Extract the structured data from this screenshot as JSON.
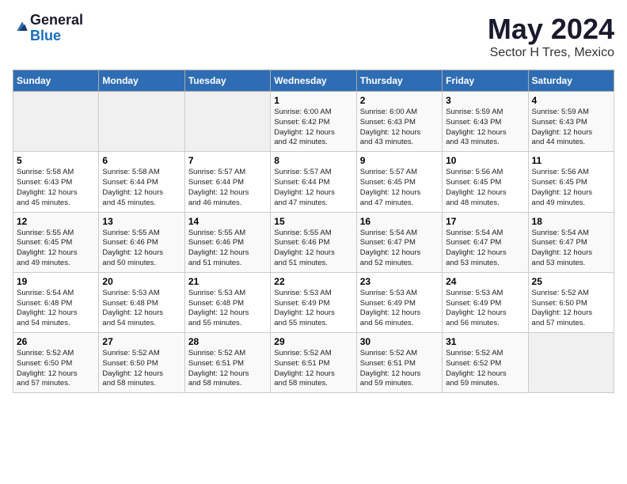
{
  "logo": {
    "general": "General",
    "blue": "Blue"
  },
  "title": "May 2024",
  "subtitle": "Sector H Tres, Mexico",
  "days_of_week": [
    "Sunday",
    "Monday",
    "Tuesday",
    "Wednesday",
    "Thursday",
    "Friday",
    "Saturday"
  ],
  "weeks": [
    [
      {
        "day": "",
        "info": ""
      },
      {
        "day": "",
        "info": ""
      },
      {
        "day": "",
        "info": ""
      },
      {
        "day": "1",
        "info": "Sunrise: 6:00 AM\nSunset: 6:42 PM\nDaylight: 12 hours\nand 42 minutes."
      },
      {
        "day": "2",
        "info": "Sunrise: 6:00 AM\nSunset: 6:43 PM\nDaylight: 12 hours\nand 43 minutes."
      },
      {
        "day": "3",
        "info": "Sunrise: 5:59 AM\nSunset: 6:43 PM\nDaylight: 12 hours\nand 43 minutes."
      },
      {
        "day": "4",
        "info": "Sunrise: 5:59 AM\nSunset: 6:43 PM\nDaylight: 12 hours\nand 44 minutes."
      }
    ],
    [
      {
        "day": "5",
        "info": "Sunrise: 5:58 AM\nSunset: 6:43 PM\nDaylight: 12 hours\nand 45 minutes."
      },
      {
        "day": "6",
        "info": "Sunrise: 5:58 AM\nSunset: 6:44 PM\nDaylight: 12 hours\nand 45 minutes."
      },
      {
        "day": "7",
        "info": "Sunrise: 5:57 AM\nSunset: 6:44 PM\nDaylight: 12 hours\nand 46 minutes."
      },
      {
        "day": "8",
        "info": "Sunrise: 5:57 AM\nSunset: 6:44 PM\nDaylight: 12 hours\nand 47 minutes."
      },
      {
        "day": "9",
        "info": "Sunrise: 5:57 AM\nSunset: 6:45 PM\nDaylight: 12 hours\nand 47 minutes."
      },
      {
        "day": "10",
        "info": "Sunrise: 5:56 AM\nSunset: 6:45 PM\nDaylight: 12 hours\nand 48 minutes."
      },
      {
        "day": "11",
        "info": "Sunrise: 5:56 AM\nSunset: 6:45 PM\nDaylight: 12 hours\nand 49 minutes."
      }
    ],
    [
      {
        "day": "12",
        "info": "Sunrise: 5:55 AM\nSunset: 6:45 PM\nDaylight: 12 hours\nand 49 minutes."
      },
      {
        "day": "13",
        "info": "Sunrise: 5:55 AM\nSunset: 6:46 PM\nDaylight: 12 hours\nand 50 minutes."
      },
      {
        "day": "14",
        "info": "Sunrise: 5:55 AM\nSunset: 6:46 PM\nDaylight: 12 hours\nand 51 minutes."
      },
      {
        "day": "15",
        "info": "Sunrise: 5:55 AM\nSunset: 6:46 PM\nDaylight: 12 hours\nand 51 minutes."
      },
      {
        "day": "16",
        "info": "Sunrise: 5:54 AM\nSunset: 6:47 PM\nDaylight: 12 hours\nand 52 minutes."
      },
      {
        "day": "17",
        "info": "Sunrise: 5:54 AM\nSunset: 6:47 PM\nDaylight: 12 hours\nand 53 minutes."
      },
      {
        "day": "18",
        "info": "Sunrise: 5:54 AM\nSunset: 6:47 PM\nDaylight: 12 hours\nand 53 minutes."
      }
    ],
    [
      {
        "day": "19",
        "info": "Sunrise: 5:54 AM\nSunset: 6:48 PM\nDaylight: 12 hours\nand 54 minutes."
      },
      {
        "day": "20",
        "info": "Sunrise: 5:53 AM\nSunset: 6:48 PM\nDaylight: 12 hours\nand 54 minutes."
      },
      {
        "day": "21",
        "info": "Sunrise: 5:53 AM\nSunset: 6:48 PM\nDaylight: 12 hours\nand 55 minutes."
      },
      {
        "day": "22",
        "info": "Sunrise: 5:53 AM\nSunset: 6:49 PM\nDaylight: 12 hours\nand 55 minutes."
      },
      {
        "day": "23",
        "info": "Sunrise: 5:53 AM\nSunset: 6:49 PM\nDaylight: 12 hours\nand 56 minutes."
      },
      {
        "day": "24",
        "info": "Sunrise: 5:53 AM\nSunset: 6:49 PM\nDaylight: 12 hours\nand 56 minutes."
      },
      {
        "day": "25",
        "info": "Sunrise: 5:52 AM\nSunset: 6:50 PM\nDaylight: 12 hours\nand 57 minutes."
      }
    ],
    [
      {
        "day": "26",
        "info": "Sunrise: 5:52 AM\nSunset: 6:50 PM\nDaylight: 12 hours\nand 57 minutes."
      },
      {
        "day": "27",
        "info": "Sunrise: 5:52 AM\nSunset: 6:50 PM\nDaylight: 12 hours\nand 58 minutes."
      },
      {
        "day": "28",
        "info": "Sunrise: 5:52 AM\nSunset: 6:51 PM\nDaylight: 12 hours\nand 58 minutes."
      },
      {
        "day": "29",
        "info": "Sunrise: 5:52 AM\nSunset: 6:51 PM\nDaylight: 12 hours\nand 58 minutes."
      },
      {
        "day": "30",
        "info": "Sunrise: 5:52 AM\nSunset: 6:51 PM\nDaylight: 12 hours\nand 59 minutes."
      },
      {
        "day": "31",
        "info": "Sunrise: 5:52 AM\nSunset: 6:52 PM\nDaylight: 12 hours\nand 59 minutes."
      },
      {
        "day": "",
        "info": ""
      }
    ]
  ]
}
